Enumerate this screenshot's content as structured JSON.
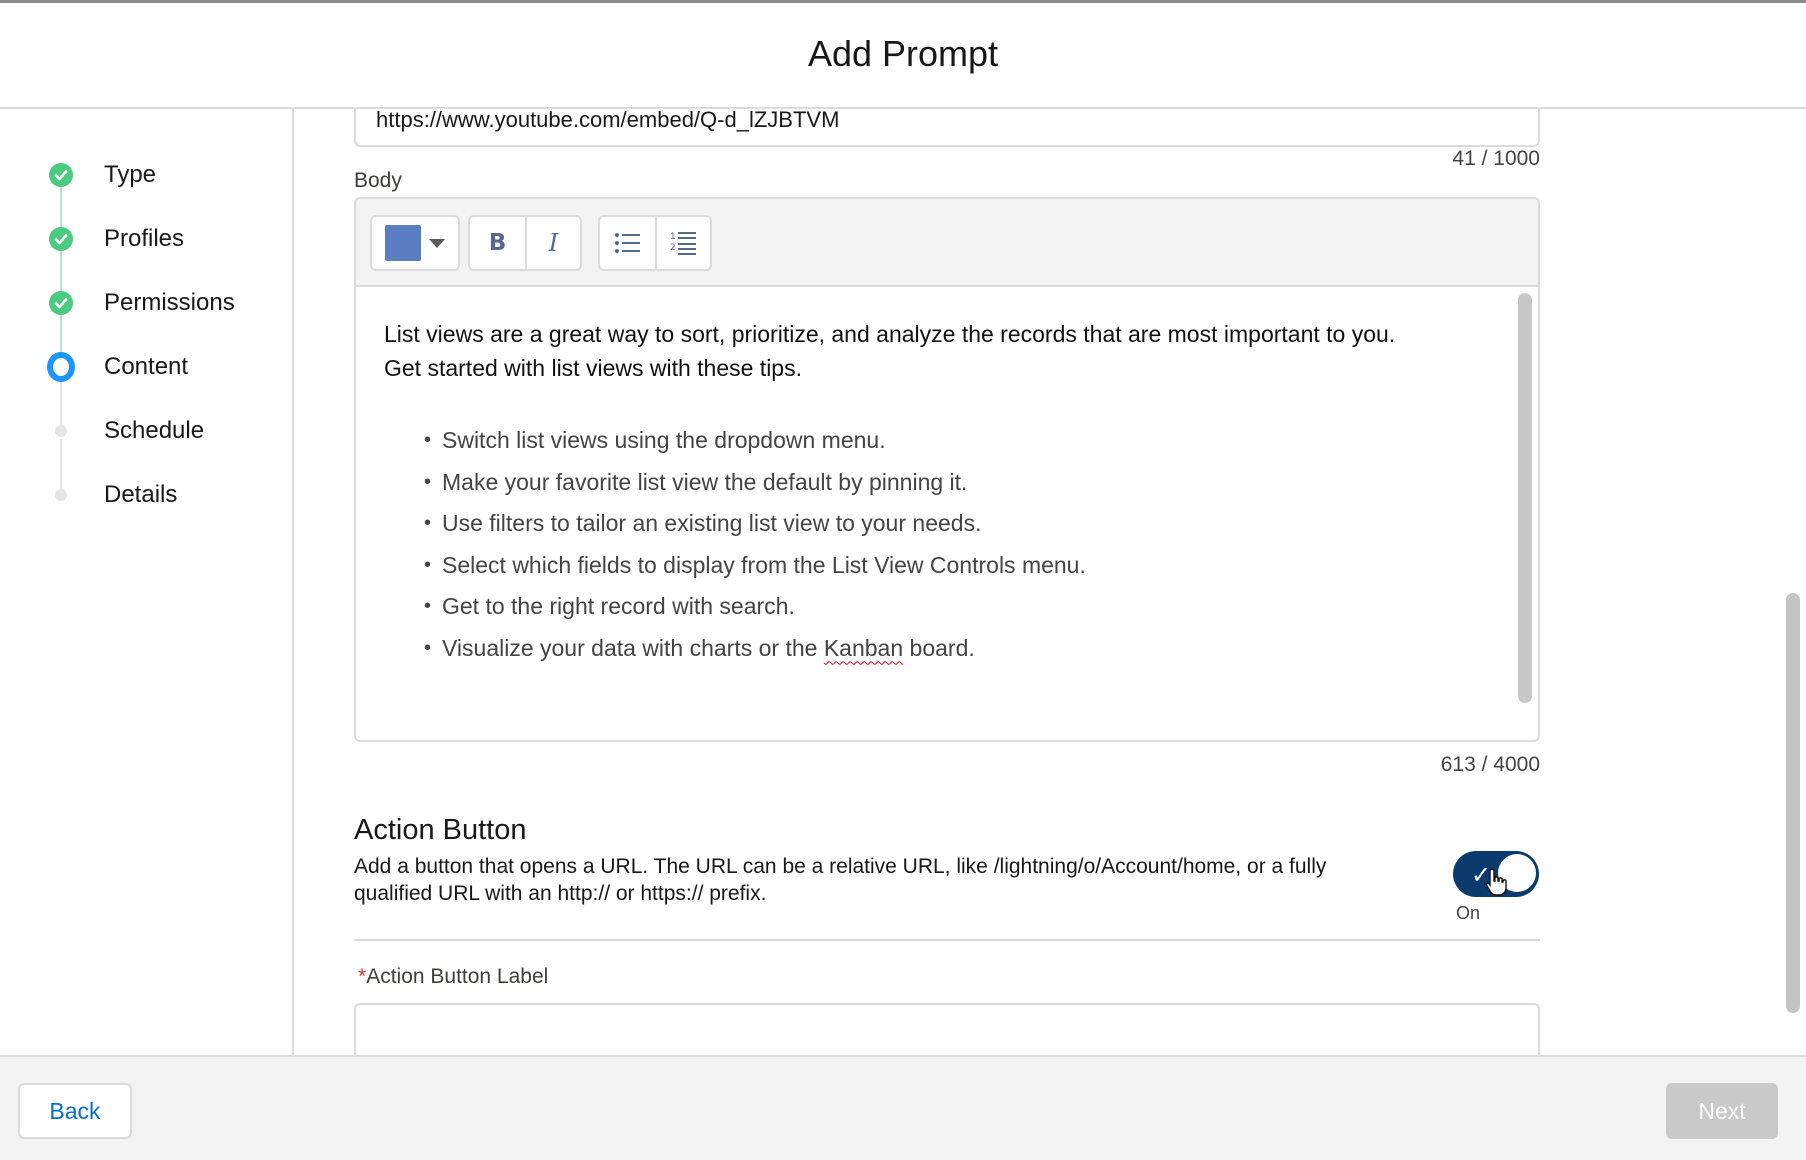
{
  "modal": {
    "title": "Add Prompt"
  },
  "steps": [
    {
      "label": "Type",
      "status": "complete"
    },
    {
      "label": "Profiles",
      "status": "complete"
    },
    {
      "label": "Permissions",
      "status": "complete"
    },
    {
      "label": "Content",
      "status": "current"
    },
    {
      "label": "Schedule",
      "status": "pending"
    },
    {
      "label": "Details",
      "status": "pending"
    }
  ],
  "video_url": {
    "value": "https://www.youtube.com/embed/Q-d_lZJBTVM",
    "count": "41 / 1000"
  },
  "body": {
    "label": "Body",
    "toolbar": {
      "color_swatch": "#5b7ec3",
      "bold": "B",
      "italic": "I"
    },
    "intro_line1": "List views are a great way to sort, prioritize, and analyze the records that are most important to you.",
    "intro_line2": "Get started with list views with these tips.",
    "tips": [
      "Switch list views using the dropdown menu.",
      "Make your favorite list view the default by pinning it.",
      "Use filters to tailor an existing list view to your needs.",
      "Select which fields to display from the List View Controls menu.",
      "Get to the right record with search."
    ],
    "last_tip_before": "Visualize your data with charts or the ",
    "last_tip_word": "Kanban",
    "last_tip_after": " board.",
    "count": "613 / 4000"
  },
  "action_button": {
    "title": "Action Button",
    "help": "Add a button that opens a URL. The URL can be a relative URL, like /lightning/o/Account/home, or a fully qualified URL with an http:// or https:// prefix.",
    "toggle_state": "On",
    "label_field": {
      "required_mark": "*",
      "label": "Action Button Label",
      "value": ""
    }
  },
  "footer": {
    "back": "Back",
    "next": "Next"
  },
  "colors": {
    "accent": "#0070d2",
    "complete": "#4bca81",
    "current": "#1b96ff",
    "toggle_on": "#0b3a6e"
  }
}
